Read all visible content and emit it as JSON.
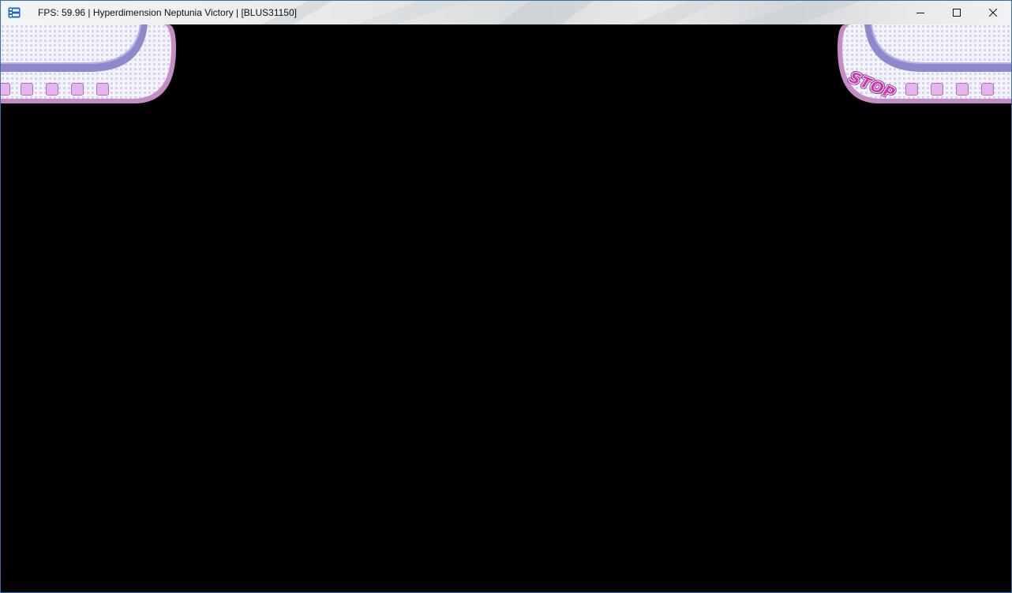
{
  "window": {
    "title": "FPS: 59.96 | Hyperdimension Neptunia Victory | [BLUS31150]",
    "app_icon": "rpcs3-emulator-icon",
    "controls": [
      "minimize",
      "maximize",
      "close"
    ]
  },
  "game_hud": {
    "left_panel": {
      "indicator_count": 5
    },
    "right_panel": {
      "status_label": "STOP",
      "indicator_count": 4
    }
  },
  "colors": {
    "titlebar_bg": "#e6e8ea",
    "viewport_bg": "#000000",
    "hud_border": "#c58cc6",
    "hud_track": "#8e88cc",
    "hud_indicator": "#e7b4f0",
    "stop_label": "#d436b5"
  }
}
